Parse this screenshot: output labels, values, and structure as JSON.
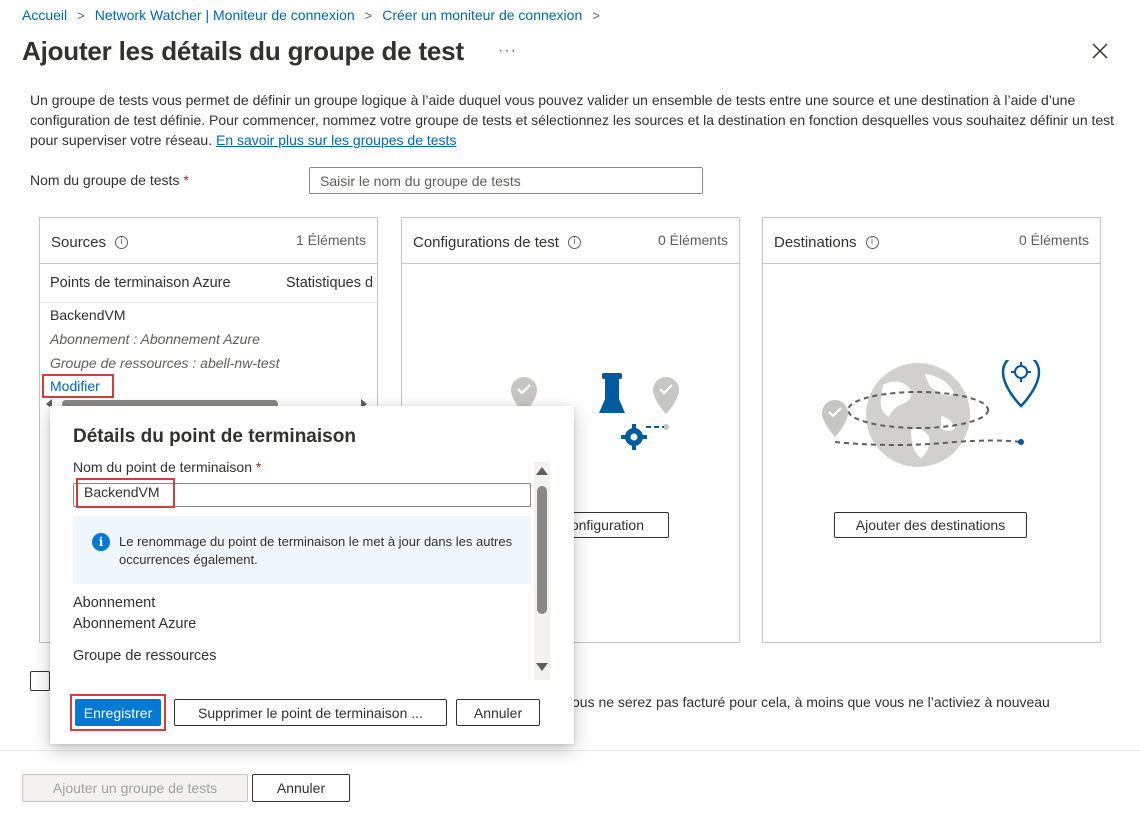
{
  "breadcrumb": [
    "Accueil",
    "Network Watcher | Moniteur de connexion",
    "Créer un moniteur de connexion"
  ],
  "page": {
    "title": "Ajouter les détails du groupe de test",
    "more": "···",
    "intro": "Un groupe de tests vous permet de définir un groupe logique à l’aide duquel vous pouvez valider un ensemble de tests entre une source et une destination à l’aide d’une configuration de test définie. Pour commencer, nommez votre groupe de tests et sélectionnez les sources et la destination en fonction desquelles vous souhaitez définir un test pour superviser votre réseau.",
    "intro_link": "En savoir plus sur les groupes de tests"
  },
  "group_name": {
    "label": "Nom du groupe de tests",
    "required_mark": "*",
    "placeholder": "Saisir le nom du groupe de tests"
  },
  "sources": {
    "title": "Sources",
    "count": "1 Éléments",
    "columns": [
      "Points de terminaison Azure",
      "Statistiques d"
    ],
    "item": {
      "name": "BackendVM",
      "subscription": "Abonnement : Abonnement Azure",
      "resource_group": "Groupe de ressources : abell-nw-test",
      "edit": "Modifier"
    }
  },
  "configs": {
    "title": "Configurations de test",
    "count": "0 Éléments",
    "button_visible": "onfiguration"
  },
  "destinations": {
    "title": "Destinations",
    "count": "0 Éléments",
    "button": "Ajouter des destinations"
  },
  "note": "ous ne serez pas facturé pour cela, à moins que vous ne l’activiez à nouveau",
  "footer": {
    "add_group": "Ajouter un groupe de tests",
    "cancel": "Annuler"
  },
  "modal": {
    "title": "Détails du point de terminaison",
    "name_label": "Nom du point de terminaison",
    "required_mark": "*",
    "name_value": "BackendVM",
    "info": "Le renommage du point de terminaison le met à jour dans les autres occurrences également.",
    "subscription_label": "Abonnement",
    "subscription_value": "Abonnement Azure",
    "resource_group_label": "Groupe de ressources",
    "save": "Enregistrer",
    "delete": "Supprimer le point de terminaison ...",
    "cancel": "Annuler"
  },
  "colors": {
    "link": "#0067b8",
    "primary": "#0078d4",
    "highlight": "#d83b3b",
    "icon_gray": "#c8c6c4",
    "icon_blue": "#005a9e"
  }
}
